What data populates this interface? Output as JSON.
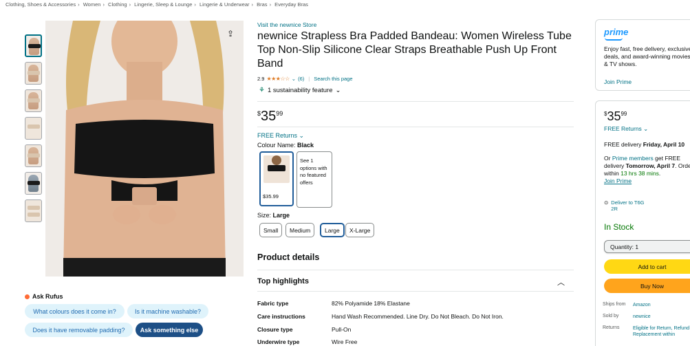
{
  "breadcrumb": [
    "Clothing, Shoes & Accessories",
    "Women",
    "Clothing",
    "Lingerie, Sleep & Lounge",
    "Lingerie & Underwear",
    "Bras",
    "Everyday Bras"
  ],
  "gallery": {
    "thumb_count": 7,
    "active_index": 0
  },
  "rufus": {
    "title": "Ask Rufus",
    "chips": [
      "What colours does it come in?",
      "Is it machine washable?",
      "Does it have removable padding?",
      "Ask something else"
    ]
  },
  "product": {
    "store_link": "Visit the newnice Store",
    "title": "newnice Strapless Bra Padded Bandeau: Women Wireless Tube Top Non-Slip Silicone Clear Straps Breathable Push Up Front Band",
    "rating": "2.9",
    "stars": "★★★☆☆",
    "review_count": "(6)",
    "search_link": "Search this page",
    "sustainability": "1 sustainability feature",
    "price": {
      "symbol": "$",
      "whole": "35",
      "fraction": "99"
    },
    "free_returns": "FREE Returns",
    "colour_label": "Colour Name:",
    "colour_value": "Black",
    "swatch_price": "$35.99",
    "see_options": "See 1 options with no featured offers",
    "size_label": "Size:",
    "size_value": "Large",
    "sizes": [
      "Small",
      "Medium",
      "Large",
      "X-Large"
    ],
    "selected_size": "Large"
  },
  "details": {
    "product_details_heading": "Product details",
    "top_highlights_heading": "Top highlights",
    "specs": [
      {
        "k": "Fabric type",
        "v": "82% Polyamide 18% Elastane"
      },
      {
        "k": "Care instructions",
        "v": "Hand Wash Recommended. Line Dry. Do Not Bleach. Do Not Iron."
      },
      {
        "k": "Closure type",
        "v": "Pull-On"
      },
      {
        "k": "Underwire type",
        "v": "Wire Free"
      }
    ]
  },
  "prime": {
    "logo": "prime",
    "text": "Enjoy fast, free delivery, exclusive deals, and award-winning movies & TV shows.",
    "join": "Join Prime"
  },
  "buybox": {
    "price": {
      "symbol": "$",
      "whole": "35",
      "fraction": "99"
    },
    "free_returns": "FREE Returns",
    "delivery_prefix": "FREE delivery ",
    "delivery_date": "Friday, April 10",
    "members_prefix": "Or ",
    "members_link": "Prime members",
    "members_mid": " get FREE delivery ",
    "members_date": "Tomorrow, April 7",
    "order_within_prefix": ". Order within ",
    "order_within": "13 hrs 38 mins",
    "order_within_suffix": ".",
    "join": "Join Prime",
    "deliver_to": "Deliver to  T6G 2R",
    "stock": "In Stock",
    "quantity": "Quantity: 1",
    "add_to_cart": "Add to cart",
    "buy_now": "Buy Now",
    "ships_from_k": "Ships from",
    "ships_from_v": "Amazon",
    "sold_by_k": "Sold by",
    "sold_by_v": "newnice",
    "returns_k": "Returns",
    "returns_v": "Eligible for Return, Refund or Replacement within"
  },
  "colors": {
    "link": "#007185",
    "accent": "#1f5c99",
    "cart": "#ffd814",
    "buy": "#ffa41c",
    "stock": "#007600",
    "stars": "#de7921"
  }
}
